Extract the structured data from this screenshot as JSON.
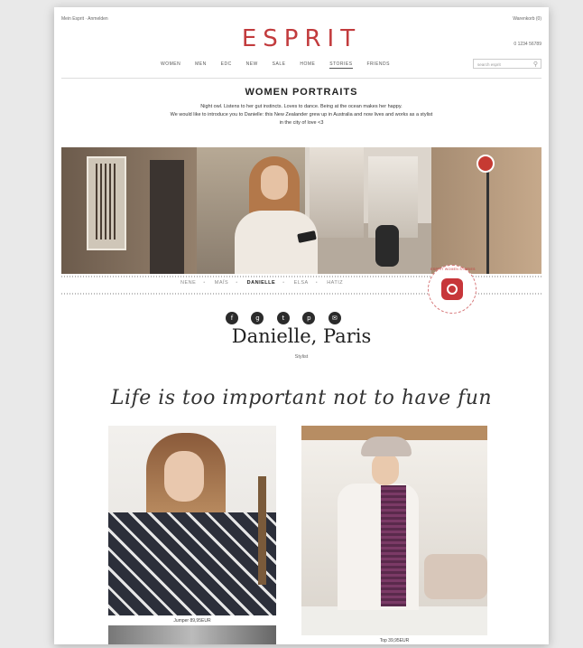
{
  "topbar": {
    "left": "Mein Esprit  ·  Anmelden",
    "right": "Warenkorb (0)",
    "phone": "0 1234 56789"
  },
  "brand": {
    "logo": "ESPRIT",
    "accent": "#c23b3d"
  },
  "nav": {
    "items": [
      "WOMEN",
      "MEN",
      "EDC",
      "NEW",
      "SALE",
      "HOME",
      "STORIES",
      "FRIENDS"
    ],
    "active_index": 6
  },
  "search": {
    "placeholder": "search esprit"
  },
  "section": {
    "title": "WOMEN PORTRAITS"
  },
  "intro": {
    "line1": "Night owl. Listens to her gut instincts. Loves to dance. Being at the ocean makes her happy.",
    "line2": "We would like to introduce you to Danielle: this New Zealander grew up in Australia and now lives and works as a stylist",
    "line3": "in the city of love <3"
  },
  "subnav": {
    "items": [
      "NENE",
      "MAÏS",
      "DANIELLE",
      "ELSA",
      "HATIZ"
    ],
    "current_index": 2
  },
  "instagram_badge": {
    "text": "ESPRIT WOMEN STORIES"
  },
  "social": {
    "icons": [
      {
        "name": "facebook-icon",
        "glyph": "f"
      },
      {
        "name": "google-plus-icon",
        "glyph": "g"
      },
      {
        "name": "twitter-icon",
        "glyph": "t"
      },
      {
        "name": "pinterest-icon",
        "glyph": "p"
      },
      {
        "name": "mail-icon",
        "glyph": "✉"
      }
    ]
  },
  "profile": {
    "name": "Danielle, Paris",
    "role": "Stylist",
    "quote": "Life is too important not to have fun"
  },
  "photos": {
    "caption1": "Jumper 89,95EUR",
    "caption2": "Top 39,95EUR"
  }
}
